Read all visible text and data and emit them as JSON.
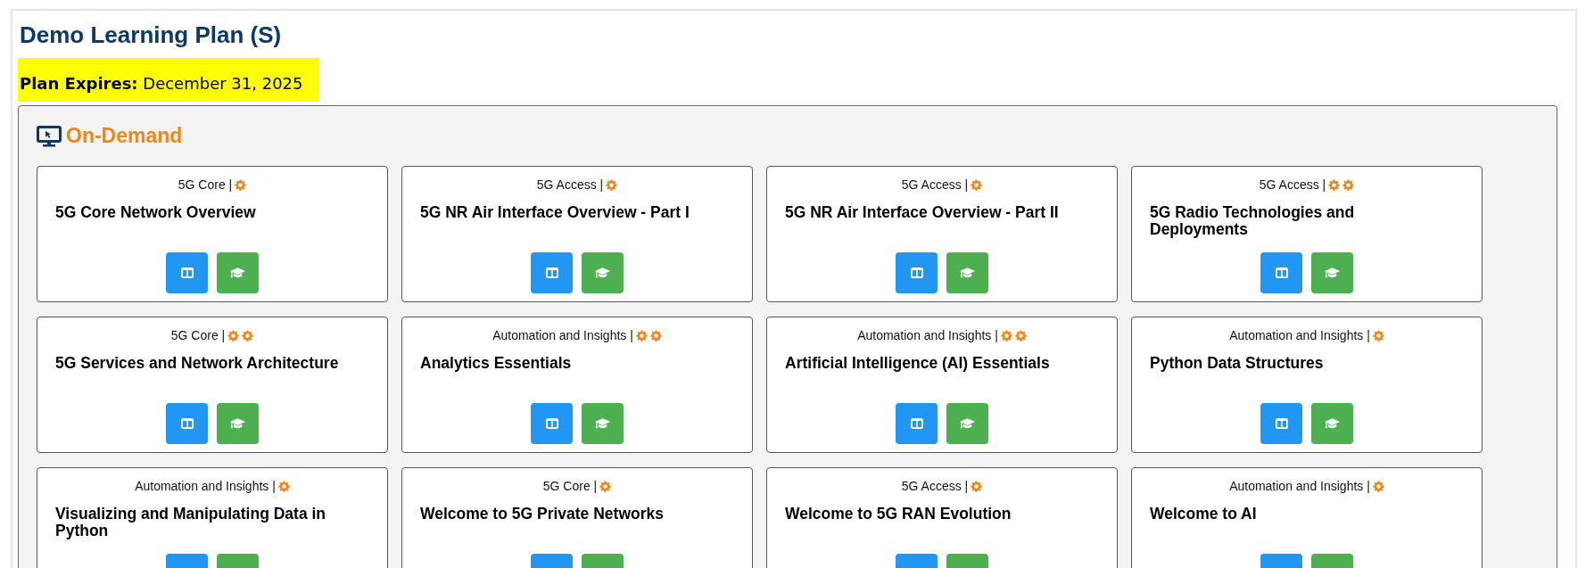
{
  "page": {
    "title": "Demo Learning Plan (S)",
    "expiry_label": "Plan Expires:",
    "expiry_date": "December 31, 2025"
  },
  "section": {
    "title": "On-Demand",
    "courses": [
      {
        "category": "5G Core |",
        "rating_icons": [
          {
            "kind": "gear"
          }
        ],
        "title": "5G Core Network Overview"
      },
      {
        "category": "5G Access |",
        "rating_icons": [
          {
            "kind": "gear"
          }
        ],
        "title": "5G NR Air Interface Overview - Part I"
      },
      {
        "category": "5G Access |",
        "rating_icons": [
          {
            "kind": "gear"
          }
        ],
        "title": "5G NR Air Interface Overview - Part II"
      },
      {
        "category": "5G Access |",
        "rating_icons": [
          {
            "kind": "gear"
          },
          {
            "kind": "gear"
          }
        ],
        "title": "5G Radio Technologies and Deployments"
      },
      {
        "category": "5G Core |",
        "rating_icons": [
          {
            "kind": "gear"
          },
          {
            "kind": "gear"
          }
        ],
        "title": "5G Services and Network Architecture"
      },
      {
        "category": "Automation and Insights |",
        "rating_icons": [
          {
            "kind": "gear"
          },
          {
            "kind": "gear"
          }
        ],
        "title": "Analytics Essentials"
      },
      {
        "category": "Automation and Insights |",
        "rating_icons": [
          {
            "kind": "gear"
          },
          {
            "kind": "gear"
          }
        ],
        "title": "Artificial Intelligence (AI) Essentials"
      },
      {
        "category": "Automation and Insights |",
        "rating_icons": [
          {
            "kind": "gear"
          }
        ],
        "title": "Python Data Structures"
      },
      {
        "category": "Automation and Insights |",
        "rating_icons": [
          {
            "kind": "gear"
          }
        ],
        "title": "Visualizing and Manipulating Data in Python"
      },
      {
        "category": "5G Core |",
        "rating_icons": [
          {
            "kind": "gear"
          }
        ],
        "title": "Welcome to 5G Private Networks"
      },
      {
        "category": "5G Access |",
        "rating_icons": [
          {
            "kind": "gear"
          }
        ],
        "title": "Welcome to 5G RAN Evolution"
      },
      {
        "category": "Automation and Insights |",
        "rating_icons": [
          {
            "kind": "gear"
          }
        ],
        "title": "Welcome to AI"
      }
    ]
  }
}
